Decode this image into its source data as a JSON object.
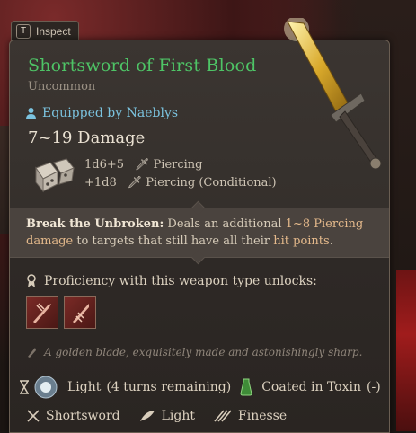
{
  "inspect": {
    "key": "T",
    "label": "Inspect"
  },
  "item": {
    "name": "Shortsword of First Blood",
    "rarity": "Uncommon",
    "equipped": "Equipped by Naeblys",
    "damage": "7~19 Damage",
    "damage_rows": [
      {
        "dice": "1d6+5",
        "type": "Piercing"
      },
      {
        "dice": "+1d8",
        "type": "Piercing (Conditional)"
      }
    ]
  },
  "passive": {
    "name": "Break the Unbroken:",
    "text_1": "Deals an additional",
    "range": "1~8 Piercing",
    "text_2": "damage",
    "text_3": "to targets that still have all their",
    "hp": "hit points",
    "text_4": "."
  },
  "proficiency": {
    "label": "Proficiency with this weapon type unlocks:"
  },
  "flavor": "A golden blade, exquisitely made and astonishingly sharp.",
  "status": {
    "light": "Light",
    "light_remaining": "(4 turns remaining)",
    "coated": "Coated in Toxin",
    "coated_value": "(-)"
  },
  "properties": [
    {
      "label": "Shortsword",
      "icon": "crossed-swords-icon"
    },
    {
      "label": "Light",
      "icon": "feather-icon"
    },
    {
      "label": "Finesse",
      "icon": "finesse-icon"
    }
  ],
  "colors": {
    "title": "#4ec466",
    "rarity": "#9d9386",
    "equipped": "#7bc3df",
    "panel": "#35302c"
  }
}
